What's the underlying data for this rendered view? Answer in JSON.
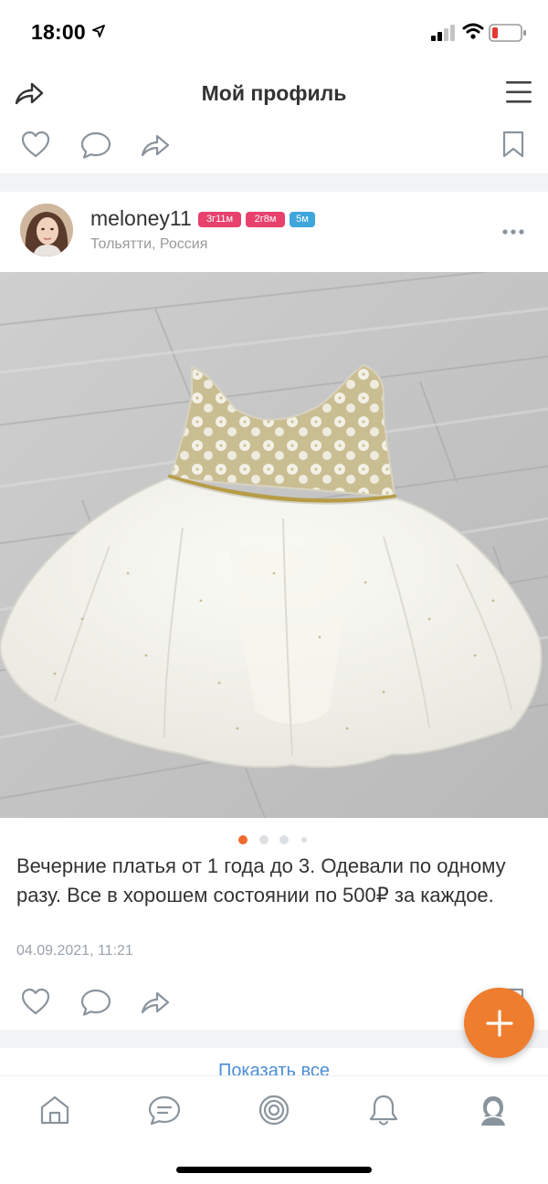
{
  "status_bar": {
    "time": "18:00",
    "icons": [
      "location-arrow-icon",
      "cellular-signal-icon",
      "wifi-icon",
      "battery-low-icon"
    ]
  },
  "header": {
    "title": "Мой профиль",
    "icons": [
      "share-icon",
      "menu-icon"
    ]
  },
  "previous_post_actions": {
    "icons": [
      "like-heart-icon",
      "comment-bubble-icon",
      "share-icon",
      "bookmark-icon"
    ]
  },
  "post": {
    "username": "meloney11",
    "badges": [
      {
        "label": "3г11м",
        "color": "#e8416e"
      },
      {
        "label": "2г8м",
        "color": "#e8416e"
      },
      {
        "label": "5м",
        "color": "#3fa6dc"
      }
    ],
    "location": "Тольятти, Россия",
    "photo_count": 4,
    "active_photo_index": 1,
    "description": "Вечерние платья от 1 года до 3. Одевали по одному разу. Все в хорошем состоянии по 500₽ за каждое.",
    "date": "04.09.2021, 11:21",
    "action_icons": [
      "like-heart-icon",
      "comment-bubble-icon",
      "share-icon",
      "bookmark-icon"
    ]
  },
  "show_all_label": "Показать все",
  "fab": {
    "icon": "plus-icon",
    "color": "#ef7d2e"
  },
  "tabbar": {
    "items": [
      {
        "icon": "home-icon"
      },
      {
        "icon": "messages-icon"
      },
      {
        "icon": "target-icon"
      },
      {
        "icon": "notifications-bell-icon"
      },
      {
        "icon": "profile-icon"
      }
    ]
  },
  "colors": {
    "accent": "#ef7d2e",
    "icon_gray": "#8a949e",
    "date_gray": "#9aa2ab",
    "link_blue": "#4b8ed8"
  }
}
